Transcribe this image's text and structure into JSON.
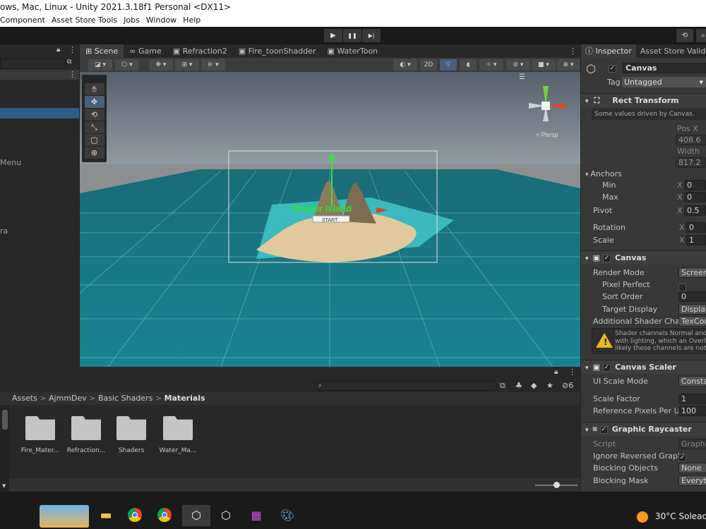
{
  "window": {
    "title": "ows, Mac, Linux - Unity 2021.3.18f1 Personal <DX11>"
  },
  "menu": [
    "Component",
    "Asset Store Tools",
    "Jobs",
    "Window",
    "Help"
  ],
  "toolbar": {
    "play": "▶",
    "pause": "❚❚",
    "step": "▶|"
  },
  "hierarchy": {
    "items": [
      {
        "label": "Menu"
      },
      {
        "label": "ra"
      }
    ]
  },
  "scene_tabs": [
    {
      "label": "Scene",
      "icon": "grid-icon"
    },
    {
      "label": "Game",
      "icon": "game-controller-icon"
    },
    {
      "label": "Refraction2",
      "icon": "scene-icon"
    },
    {
      "label": "Fire_toonShadder",
      "icon": "scene-icon"
    },
    {
      "label": "WaterToon",
      "icon": "scene-icon"
    }
  ],
  "scene_toolbar": {
    "mode_2d": "2D"
  },
  "viewport": {
    "gizmo_label": "< Persp",
    "ui_title": "Shader Island",
    "ui_button": "START"
  },
  "inspector": {
    "tabs": [
      "Inspector",
      "Asset Store Valida"
    ],
    "object_name": "Canvas",
    "tag_label": "Tag",
    "tag_value": "Untagged",
    "rect_transform": {
      "title": "Rect Transform",
      "note": "Some values driven by Canvas.",
      "pos_x_label": "Pos X",
      "pos_x": "408.6",
      "width_label": "Width",
      "width": "817.2",
      "anchors": "Anchors",
      "min": "Min",
      "max": "Max",
      "min_x": "0",
      "max_x": "0",
      "pivot": "Pivot",
      "pivot_x": "0.5",
      "rotation": "Rotation",
      "rotation_x": "0",
      "scale": "Scale",
      "scale_x": "1"
    },
    "canvas": {
      "title": "Canvas",
      "render_mode": "Render Mode",
      "render_mode_value": "Screen",
      "pixel_perfect": "Pixel Perfect",
      "sort_order": "Sort Order",
      "sort_order_value": "0",
      "target_display": "Target Display",
      "target_display_value": "Display",
      "additional_shader": "Additional Shader Chan",
      "additional_shader_value": "TexCoo",
      "warning_line1": "Shader channels Normal and",
      "warning_line2": "with lighting, which an Overla",
      "warning_line3": "likely these channels are not"
    },
    "canvas_scaler": {
      "title": "Canvas Scaler",
      "ui_scale_mode": "UI Scale Mode",
      "ui_scale_mode_value": "Consta",
      "scale_factor": "Scale Factor",
      "scale_factor_value": "1",
      "ref_pixels": "Reference Pixels Per Ur",
      "ref_pixels_value": "100"
    },
    "graphic_raycaster": {
      "title": "Graphic Raycaster",
      "script": "Script",
      "script_value": "Graph",
      "ignore_reversed": "Ignore Reversed Graphi",
      "blocking_objects": "Blocking Objects",
      "blocking_objects_value": "None",
      "blocking_mask": "Blocking Mask",
      "blocking_mask_value": "Everyth"
    }
  },
  "project": {
    "breadcrumb": [
      "Assets",
      "AjmmDev",
      "Basic Shaders",
      "Materials"
    ],
    "separator": ">",
    "hidden_count": "6",
    "folders": [
      {
        "label": "Fire_Mater..."
      },
      {
        "label": "Refraction..."
      },
      {
        "label": "Shaders"
      },
      {
        "label": "Water_Ma..."
      }
    ]
  },
  "taskbar": {
    "weather_temp": "30°C",
    "weather_text": "Soleado"
  },
  "colors": {
    "accent": "#2c5d87",
    "ui_title_green": "#2fe02f",
    "water": "#1e8a9a"
  }
}
